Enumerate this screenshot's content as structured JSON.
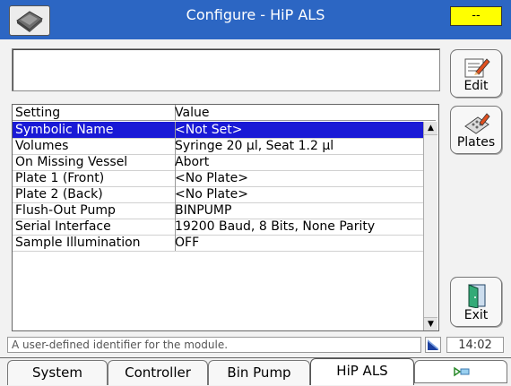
{
  "title": "Configure - HiP ALS",
  "status_indicator": "--",
  "buttons": {
    "edit": "Edit",
    "plates": "Plates",
    "exit": "Exit"
  },
  "table": {
    "headers": [
      "Setting",
      "Value"
    ],
    "rows": [
      {
        "setting": "Symbolic Name",
        "value": "<Not Set>",
        "selected": true
      },
      {
        "setting": "Volumes",
        "value": "Syringe 20 µl, Seat 1.2 µl"
      },
      {
        "setting": "On Missing Vessel",
        "value": "Abort"
      },
      {
        "setting": "Plate 1 (Front)",
        "value": "<No Plate>"
      },
      {
        "setting": "Plate 2 (Back)",
        "value": "<No Plate>"
      },
      {
        "setting": "Flush-Out Pump",
        "value": "BINPUMP"
      },
      {
        "setting": "Serial Interface",
        "value": "19200 Baud, 8 Bits, None Parity"
      },
      {
        "setting": "Sample Illumination",
        "value": "OFF"
      }
    ]
  },
  "statusline": "A user-defined identifier for the module.",
  "clock": "14:02",
  "tabs": [
    "System",
    "Controller",
    "Bin Pump",
    "HiP ALS"
  ],
  "active_tab": "HiP ALS",
  "colors": {
    "titlebar": "#2c66c3",
    "selection": "#1a1ad6",
    "status_indicator": "#ffff00"
  }
}
